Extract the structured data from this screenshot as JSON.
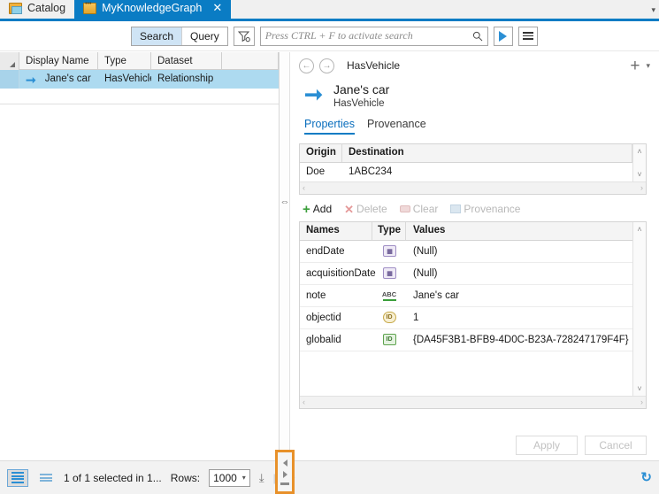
{
  "tabbar": {
    "tabs": [
      {
        "label": "Catalog",
        "icon": "catalog-icon",
        "active": false
      },
      {
        "label": "MyKnowledgeGraph",
        "icon": "knowledge-graph-icon",
        "active": true,
        "close": "✕"
      }
    ],
    "overflow_chevron": "▾"
  },
  "toolbar": {
    "search_label": "Search",
    "query_label": "Query",
    "filter_icon": "filter-icon",
    "search_placeholder": "Press CTRL + F to activate search",
    "search_value": "",
    "magnifier_icon": "search-icon",
    "run_icon": "play-icon",
    "menu_icon": "hamburger-menu-icon"
  },
  "results_grid": {
    "columns": [
      "Display Name",
      "Type",
      "Dataset"
    ],
    "rows": [
      {
        "display_name": "Jane's car",
        "type": "HasVehicle",
        "dataset": "Relationship",
        "selected": true,
        "icon": "relationship-arrow-icon"
      }
    ]
  },
  "detail": {
    "back_icon": "←",
    "forward_icon": "→",
    "breadcrumb": "HasVehicle",
    "add_icon": "+",
    "add_chevron": "▾",
    "entity": {
      "icon": "relationship-arrow-icon",
      "title": "Jane's car",
      "subtitle": "HasVehicle"
    },
    "tabs": [
      {
        "label": "Properties",
        "active": true
      },
      {
        "label": "Provenance",
        "active": false
      }
    ],
    "endpoints": {
      "columns": [
        "Origin",
        "Destination"
      ],
      "rows": [
        {
          "origin": "Doe",
          "destination": "1ABC234"
        }
      ],
      "scroll_up": "˄",
      "scroll_down": "˅",
      "scroll_left": "‹",
      "scroll_right": "›"
    },
    "actions": [
      {
        "label": "Add",
        "icon": "plus-icon",
        "enabled": true
      },
      {
        "label": "Delete",
        "icon": "delete-x-icon",
        "enabled": false
      },
      {
        "label": "Clear",
        "icon": "eraser-icon",
        "enabled": false
      },
      {
        "label": "Provenance",
        "icon": "provenance-icon",
        "enabled": false
      }
    ],
    "properties": {
      "columns": [
        "Names",
        "Type",
        "Values"
      ],
      "rows": [
        {
          "name": "endDate",
          "type_icon": "date-type-icon",
          "type_glyph": "▦",
          "value": "(Null)"
        },
        {
          "name": "acquisitionDate",
          "type_icon": "date-type-icon",
          "type_glyph": "▦",
          "value": "(Null)"
        },
        {
          "name": "note",
          "type_icon": "text-type-icon",
          "type_glyph": "ABC",
          "value": "Jane's car"
        },
        {
          "name": "objectid",
          "type_icon": "objectid-type-icon",
          "type_glyph": "ID",
          "value": "1"
        },
        {
          "name": "globalid",
          "type_icon": "globalid-type-icon",
          "type_glyph": "ID",
          "value": "{DA45F3B1-BFB9-4D0C-B23A-728247179F4F}"
        }
      ],
      "scroll_up": "˄",
      "scroll_down": "˅",
      "scroll_left": "‹",
      "scroll_right": "›"
    },
    "apply_label": "Apply",
    "cancel_label": "Cancel"
  },
  "status": {
    "selection_text": "1 of 1 selected in 1...",
    "rows_label": "Rows:",
    "rows_value": "1000",
    "rows_chevron": "▾",
    "download_icon": "⤓",
    "refresh_icon": "↻",
    "table_view_icon": "table-view-icon",
    "list_view_icon": "list-view-icon",
    "splitter_collapse_icon": "splitter-collapse-icon"
  },
  "colors": {
    "accent": "#0a7cc4",
    "selection": "#addaf0",
    "highlight_box": "#e8912a"
  }
}
